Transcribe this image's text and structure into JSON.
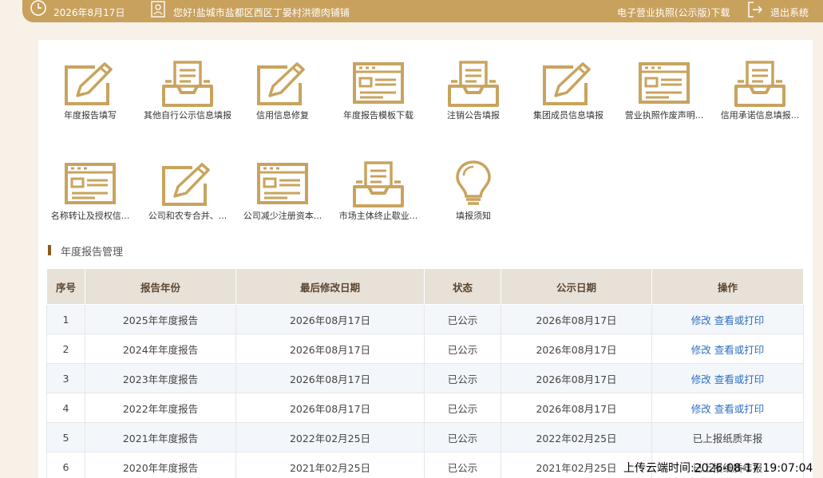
{
  "topbar": {
    "date": "2026年8月17日",
    "greeting": "您好!盐城市盐都区西区丁晏村洪德肉铺铺",
    "license_link": "电子营业执照(公示版)下载",
    "logout": "退出系统"
  },
  "functions": [
    {
      "label": "年度报告填写",
      "icon": "pencil-doc-icon"
    },
    {
      "label": "其他自行公示信息填报",
      "icon": "inbox-doc-icon"
    },
    {
      "label": "信用信息修复",
      "icon": "pencil-doc-icon"
    },
    {
      "label": "年度报告模板下载",
      "icon": "form-window-icon"
    },
    {
      "label": "注销公告填报",
      "icon": "inbox-doc-icon"
    },
    {
      "label": "集团成员信息填报",
      "icon": "pencil-doc-icon"
    },
    {
      "label": "营业执照作废声明...",
      "icon": "form-window-icon"
    },
    {
      "label": "信用承诺信息填报...",
      "icon": "inbox-doc-icon"
    },
    {
      "label": "名称转让及授权信...",
      "icon": "form-window-icon"
    },
    {
      "label": "公司和农专合并、...",
      "icon": "pencil-doc-icon"
    },
    {
      "label": "公司减少注册资本...",
      "icon": "form-window-icon"
    },
    {
      "label": "市场主体终止歇业...",
      "icon": "inbox-doc-icon"
    },
    {
      "label": "填报须知",
      "icon": "lightbulb-icon"
    }
  ],
  "section_title": "年度报告管理",
  "table": {
    "headers": [
      "序号",
      "报告年份",
      "最后修改日期",
      "状态",
      "公示日期",
      "操作"
    ],
    "rows": [
      {
        "no": "1",
        "year": "2025年年度报告",
        "modified": "2026年08月17日",
        "status": "已公示",
        "published": "2026年08月17日",
        "action_edit": "修改",
        "action_view": "查看或打印",
        "action_text": ""
      },
      {
        "no": "2",
        "year": "2024年年度报告",
        "modified": "2026年08月17日",
        "status": "已公示",
        "published": "2026年08月17日",
        "action_edit": "修改",
        "action_view": "查看或打印",
        "action_text": ""
      },
      {
        "no": "3",
        "year": "2023年年度报告",
        "modified": "2026年08月17日",
        "status": "已公示",
        "published": "2026年08月17日",
        "action_edit": "修改",
        "action_view": "查看或打印",
        "action_text": ""
      },
      {
        "no": "4",
        "year": "2022年年度报告",
        "modified": "2026年08月17日",
        "status": "已公示",
        "published": "2026年08月17日",
        "action_edit": "修改",
        "action_view": "查看或打印",
        "action_text": ""
      },
      {
        "no": "5",
        "year": "2021年年度报告",
        "modified": "2022年02月25日",
        "status": "已公示",
        "published": "2022年02月25日",
        "action_edit": "",
        "action_view": "",
        "action_text": "已上报纸质年报"
      },
      {
        "no": "6",
        "year": "2020年年度报告",
        "modified": "2021年02月25日",
        "status": "已公示",
        "published": "2021年02月25日",
        "action_edit": "",
        "action_view": "",
        "action_text": "已上报纸质年报"
      }
    ]
  },
  "upload_note": "上传云端时间:2026-08-17 19:07:04",
  "colors": {
    "accent": "#c8a15d",
    "icon": "#c9a35e",
    "link": "#2f6fbf"
  }
}
